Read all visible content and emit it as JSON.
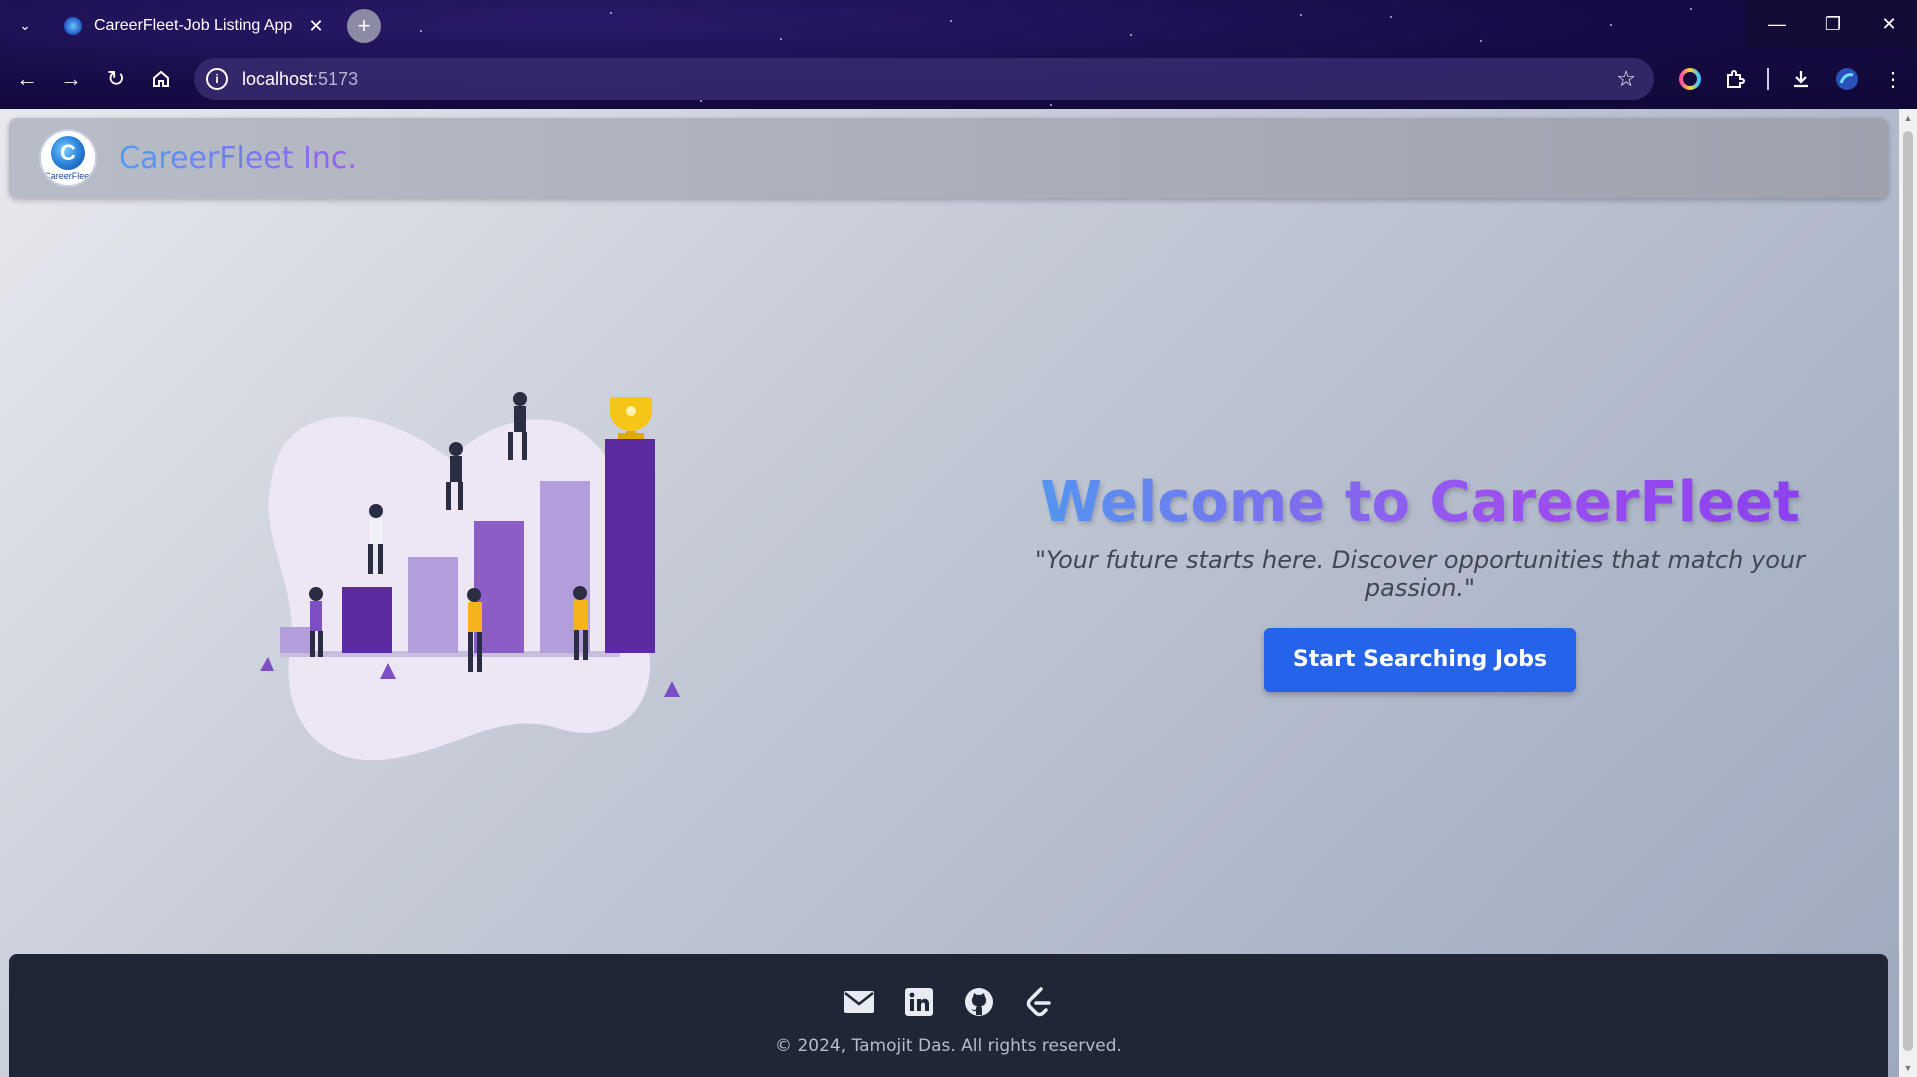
{
  "browser": {
    "tab_title": "CareerFleet-Job Listing App",
    "tab_close": "✕",
    "new_tab": "+",
    "url_host": "localhost",
    "url_port": ":5173"
  },
  "header": {
    "logo_text": "CareerFleet",
    "brand": "CareerFleet Inc."
  },
  "hero": {
    "title": "Welcome to CareerFleet",
    "tagline": "\"Your future starts here. Discover opportunities that match your passion.\"",
    "cta_label": "Start Searching Jobs"
  },
  "footer": {
    "icons": [
      "mail-icon",
      "linkedin-icon",
      "github-icon",
      "leetcode-icon"
    ],
    "copyright": "© 2024, Tamojit Das. All rights reserved."
  },
  "colors": {
    "cta": "#2563eb",
    "footer_bg": "#1f2737",
    "title_gradient_start": "#4f9af0",
    "title_gradient_end": "#9d4ff0"
  }
}
